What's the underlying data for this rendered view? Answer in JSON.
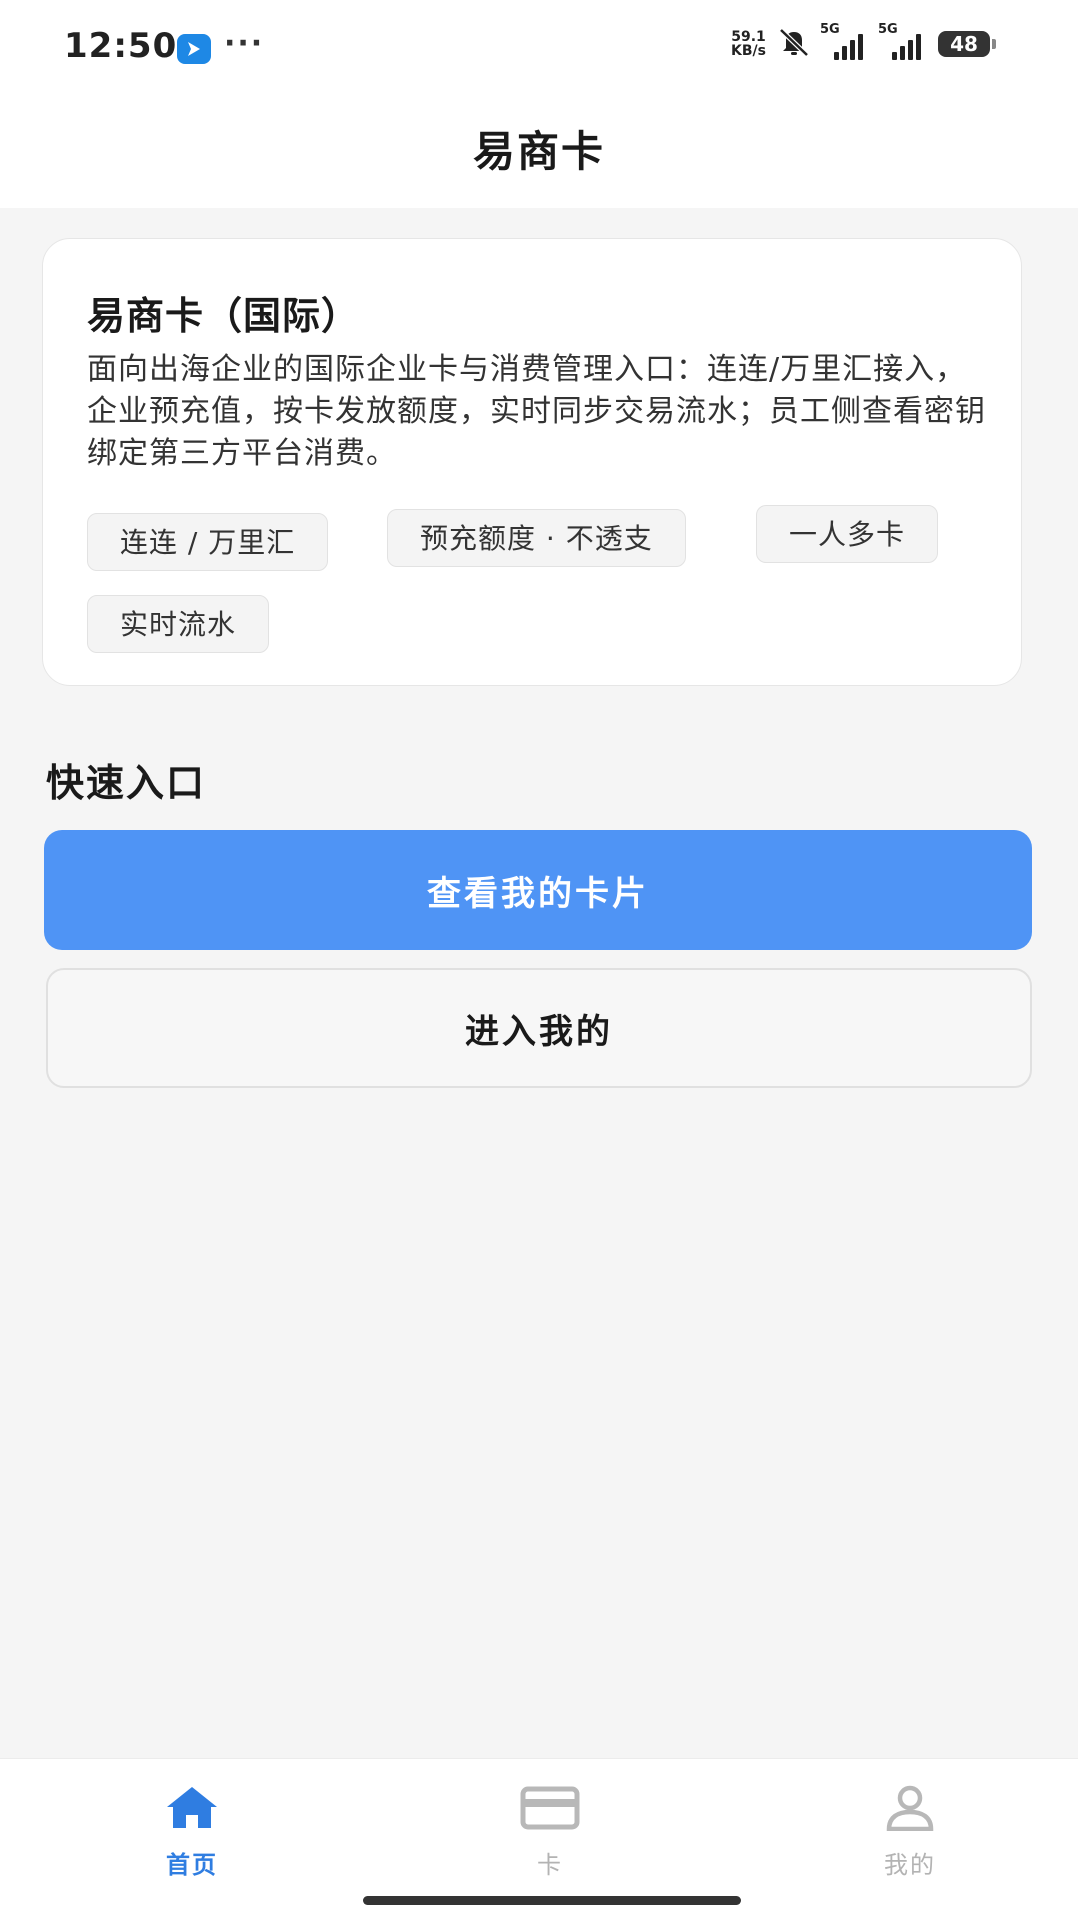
{
  "status_bar": {
    "time": "12:50",
    "more": "···",
    "net_speed_value": "59.1",
    "net_speed_unit": "KB/s",
    "signal1_label": "5G",
    "signal2_label": "5G",
    "battery": "48"
  },
  "header": {
    "title": "易商卡"
  },
  "intro_card": {
    "title": "易商卡（国际）",
    "description": "面向出海企业的国际企业卡与消费管理入口：连连/万里汇接入，企业预充值，按卡发放额度，实时同步交易流水；员工侧查看密钥绑定第三方平台消费。",
    "tags": [
      "连连 / 万里汇",
      "预充额度 · 不透支",
      "一人多卡",
      "实时流水"
    ]
  },
  "quick_entry": {
    "title": "快速入口",
    "primary_button": "查看我的卡片",
    "secondary_button": "进入我的"
  },
  "tab_bar": {
    "items": [
      {
        "label": "首页",
        "icon": "home-icon",
        "active": true
      },
      {
        "label": "卡",
        "icon": "card-icon",
        "active": false
      },
      {
        "label": "我的",
        "icon": "person-icon",
        "active": false
      }
    ]
  },
  "colors": {
    "accent": "#4f94f5",
    "tab_active": "#2f7de1",
    "tab_inactive": "#b3b3b3"
  }
}
